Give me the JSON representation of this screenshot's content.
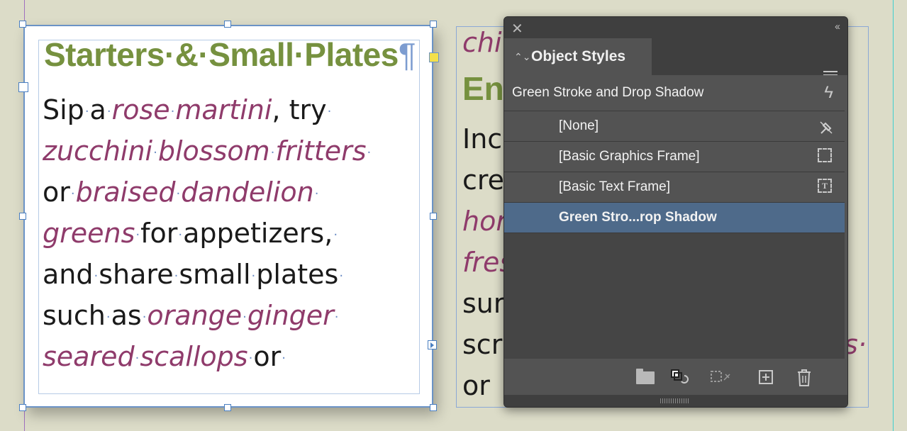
{
  "left_frame": {
    "heading": "Starters·&·Small·Plates",
    "pilcrow": "¶",
    "lines": [
      [
        {
          "t": "Sip",
          "i": false
        },
        {
          "t": "·",
          "d": true
        },
        {
          "t": "a",
          "i": false
        },
        {
          "t": "·",
          "d": true
        },
        {
          "t": "rose",
          "i": true
        },
        {
          "t": "·",
          "d": true
        },
        {
          "t": "martini",
          "i": true
        },
        {
          "t": ", try",
          "i": false
        },
        {
          "t": "·",
          "d": true
        }
      ],
      [
        {
          "t": "zucchini",
          "i": true
        },
        {
          "t": "·",
          "d": true
        },
        {
          "t": "blossom",
          "i": true
        },
        {
          "t": "·",
          "d": true
        },
        {
          "t": "fritters",
          "i": true
        },
        {
          "t": "·",
          "d": true
        }
      ],
      [
        {
          "t": "or",
          "i": false
        },
        {
          "t": "·",
          "d": true
        },
        {
          "t": "braised",
          "i": true
        },
        {
          "t": "·",
          "d": true
        },
        {
          "t": "dandelion",
          "i": true
        },
        {
          "t": "·",
          "d": true
        }
      ],
      [
        {
          "t": "greens",
          "i": true
        },
        {
          "t": "·",
          "d": true
        },
        {
          "t": "for",
          "i": false
        },
        {
          "t": "·",
          "d": true
        },
        {
          "t": "appetizers,",
          "i": false
        },
        {
          "t": "·",
          "d": true
        }
      ],
      [
        {
          "t": "and",
          "i": false
        },
        {
          "t": "·",
          "d": true
        },
        {
          "t": "share",
          "i": false
        },
        {
          "t": "·",
          "d": true
        },
        {
          "t": "small",
          "i": false
        },
        {
          "t": "·",
          "d": true
        },
        {
          "t": "plates",
          "i": false
        },
        {
          "t": "·",
          "d": true
        }
      ],
      [
        {
          "t": "such",
          "i": false
        },
        {
          "t": "·",
          "d": true
        },
        {
          "t": "as",
          "i": false
        },
        {
          "t": "·",
          "d": true
        },
        {
          "t": "orange",
          "i": true
        },
        {
          "t": "·",
          "d": true
        },
        {
          "t": "ginger",
          "i": true
        },
        {
          "t": "·",
          "d": true
        }
      ],
      [
        {
          "t": "seared",
          "i": true
        },
        {
          "t": "·",
          "d": true
        },
        {
          "t": "scallops",
          "i": true
        },
        {
          "t": "·",
          "d": true
        },
        {
          "t": "or",
          "i": false
        },
        {
          "t": "·",
          "d": true
        }
      ]
    ]
  },
  "right_frame": {
    "visible_fragments": [
      "chi",
      "En",
      "Inc",
      "cre",
      "hor",
      "fres",
      "sur",
      "scr",
      "or",
      "s·"
    ]
  },
  "panel": {
    "close_label": "✕",
    "collapse_label": "‹‹",
    "tab_label": "Object Styles",
    "tab_arrows": "⌃⌄",
    "current_style": "Green Stroke and Drop Shadow",
    "styles": [
      {
        "label": "[None]",
        "icon": "clear-override-icon",
        "selected": false
      },
      {
        "label": "[Basic Graphics Frame]",
        "icon": "graphics-frame-icon",
        "selected": false
      },
      {
        "label": "[Basic Text Frame]",
        "icon": "text-frame-icon",
        "selected": false
      },
      {
        "label": "Green Stro...rop Shadow",
        "icon": "",
        "selected": true
      }
    ],
    "footer_icons": [
      "new-style-group-icon",
      "clear-overrides-icon",
      "clear-attributes-icon",
      "new-style-icon",
      "delete-icon"
    ]
  },
  "colors": {
    "heading_green": "#76913f",
    "italic_plum": "#8f3b6b",
    "selection_blue": "#4e6a8a",
    "panel_bg": "#535353"
  }
}
